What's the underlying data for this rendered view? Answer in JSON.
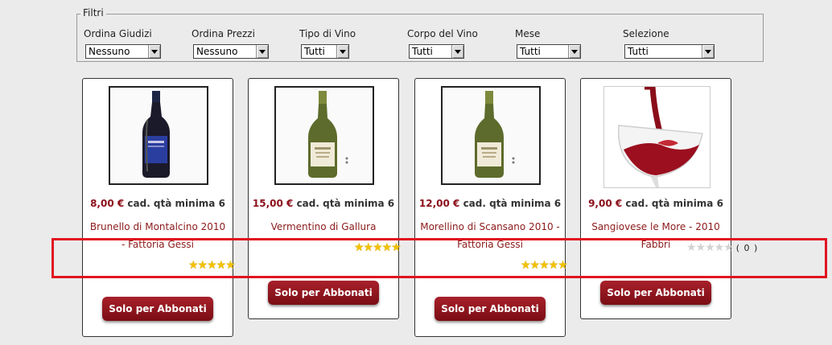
{
  "filters": {
    "legend": "Filtri",
    "groups": [
      {
        "label": "Ordina Giudizi",
        "value": "Nessuno"
      },
      {
        "label": "Ordina Prezzi",
        "value": "Nessuno"
      },
      {
        "label": "Tipo di Vino",
        "value": "Tutti"
      },
      {
        "label": "Corpo del Vino",
        "value": "Tutti"
      },
      {
        "label": "Mese",
        "value": "Tutti"
      },
      {
        "label": "Selezione",
        "value": "Tutti"
      }
    ]
  },
  "products": [
    {
      "price": "8,00 €",
      "price_suffix": "cad. qtà minima 6",
      "name": "Brunello di Montalcino 2010 - Fattoria Gessi",
      "rating_stars": 5,
      "stars": "★★★★★",
      "button": "Solo per Abbonati",
      "image_icon": "wine-bottle-blue-label"
    },
    {
      "price": "15,00 €",
      "price_suffix": "cad. qtà minima 6",
      "name": "Vermentino di Gallura",
      "rating_stars": 5,
      "stars": "★★★★★",
      "button": "Solo per Abbonati",
      "image_icon": "wine-bottle-white-label"
    },
    {
      "price": "12,00 €",
      "price_suffix": "cad. qtà minima 6",
      "name": "Morellino di Scansano 2010 - Fattoria Gessi",
      "rating_stars": 5,
      "stars": "★★★★★",
      "button": "Solo per Abbonati",
      "image_icon": "wine-bottle-white-label"
    },
    {
      "price": "9,00 €",
      "price_suffix": "cad. qtà minima 6",
      "name": "Sangiovese le More - 2010 Fabbri",
      "rating_stars": 0,
      "stars": "★★★★★",
      "rating_count": "( 0 )",
      "button": "Solo per Abbonati",
      "image_icon": "red-wine-glass-pour"
    }
  ],
  "colors": {
    "accent": "#8b0f1a",
    "highlight_box": "#e01520",
    "star_filled": "#f2c200",
    "star_empty": "#d2d2d2"
  }
}
